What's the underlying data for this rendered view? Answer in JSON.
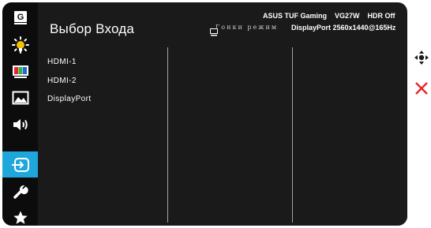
{
  "header": {
    "title": "Выбор Входа",
    "model": "ASUS TUF Gaming",
    "model_code": "VG27W",
    "hdr_status": "HDR Off",
    "mode": "Гонки режим",
    "input_status": "DisplayPort 2560x1440@165Hz"
  },
  "sidebar": {
    "items": [
      {
        "icon": "gaming-icon"
      },
      {
        "icon": "image-icon"
      },
      {
        "icon": "color-icon"
      },
      {
        "icon": "picture-icon"
      },
      {
        "icon": "sound-icon"
      },
      {
        "icon": "input-select-icon",
        "active": true
      },
      {
        "icon": "system-setup-icon"
      },
      {
        "icon": "favorite-icon"
      }
    ]
  },
  "inputs": {
    "items": [
      {
        "label": "HDMI-1"
      },
      {
        "label": "HDMI-2"
      },
      {
        "label": "DisplayPort"
      }
    ]
  },
  "controls": {
    "navigate": {
      "icon": "five-way-navigation-icon"
    },
    "close": {
      "icon": "close-icon"
    }
  },
  "colors": {
    "osd_background": "#1a1a1a",
    "sidebar_background": "#0c0c0c",
    "accent": "#1fa7dc",
    "close_red": "#e8242b"
  }
}
